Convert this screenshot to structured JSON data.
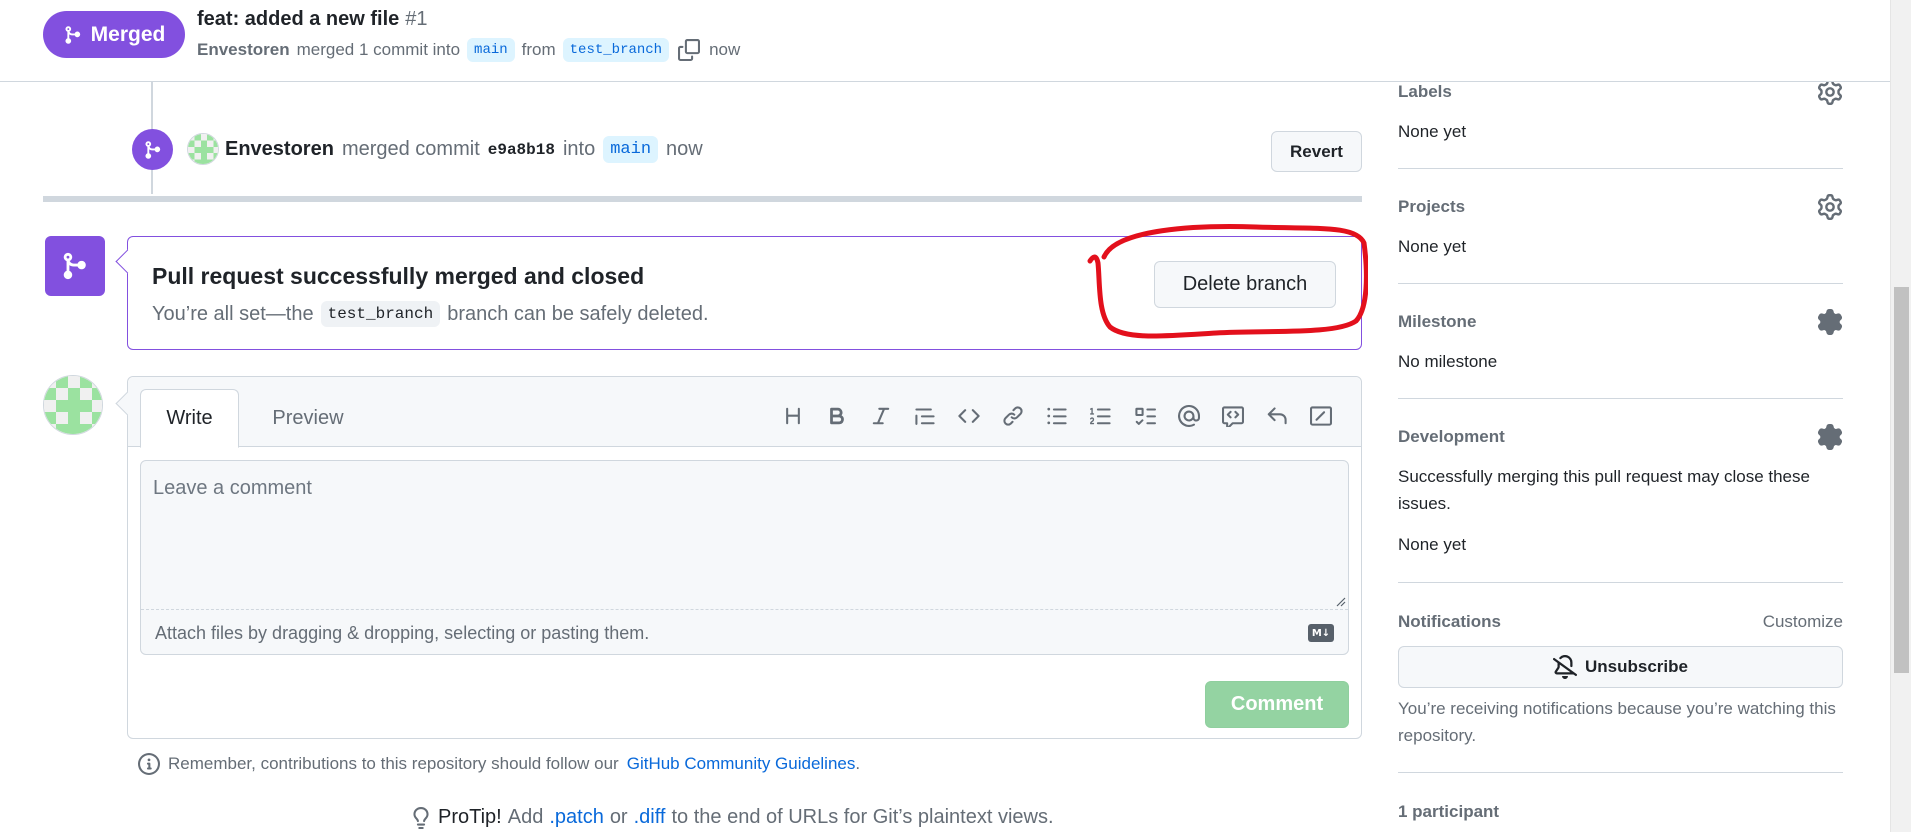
{
  "header": {
    "status_label": "Merged",
    "title": "feat: added a new file",
    "number": "#1",
    "author": "Envestoren",
    "merged_text": "merged 1 commit into",
    "base_branch": "main",
    "from_text": "from",
    "head_branch": "test_branch",
    "time": "now"
  },
  "timeline": {
    "author": "Envestoren",
    "merged_commit_text": "merged commit",
    "commit_sha": "e9a8b18",
    "into_text": "into",
    "branch": "main",
    "time": "now",
    "revert_label": "Revert"
  },
  "merge_box": {
    "title": "Pull request successfully merged and closed",
    "desc_prefix": "You’re all set—the",
    "branch": "test_branch",
    "desc_suffix": "branch can be safely deleted.",
    "delete_label": "Delete branch",
    "annotation_color": "#e3101c"
  },
  "comment": {
    "tabs": [
      "Write",
      "Preview"
    ],
    "toolbar_icons": [
      "heading-icon",
      "bold-icon",
      "italic-icon",
      "quote-icon",
      "code-icon",
      "link-icon",
      "unordered-list-icon",
      "ordered-list-icon",
      "task-list-icon",
      "mention-icon",
      "reference-icon",
      "reply-icon",
      "slash-command-icon"
    ],
    "placeholder": "Leave a comment",
    "attach_text": "Attach files by dragging & dropping, selecting or pasting them.",
    "markdown_badge": "M↓",
    "submit_label": "Comment"
  },
  "footer": {
    "guidelines_prefix": "Remember, contributions to this repository should follow our",
    "guidelines_link": "GitHub Community Guidelines",
    "guidelines_suffix": ".",
    "protip_label": "ProTip!",
    "protip_add": "Add",
    "patch": ".patch",
    "or": "or",
    "diff": ".diff",
    "protip_suffix": "to the end of URLs for Git’s plaintext views."
  },
  "sidebar": {
    "labels": {
      "heading": "Labels",
      "value": "None yet"
    },
    "projects": {
      "heading": "Projects",
      "value": "None yet"
    },
    "milestone": {
      "heading": "Milestone",
      "value": "No milestone"
    },
    "development": {
      "heading": "Development",
      "note": "Successfully merging this pull request may close these issues.",
      "value": "None yet"
    },
    "notifications": {
      "heading": "Notifications",
      "customize": "Customize",
      "unsubscribe_label": "Unsubscribe",
      "note": "You’re receiving notifications because you’re watching this repository."
    },
    "participants": {
      "heading": "1 participant"
    }
  },
  "colors": {
    "merged_purple": "#8250df",
    "link_blue": "#0969da",
    "comment_green_disabled": "#94d3a2"
  }
}
